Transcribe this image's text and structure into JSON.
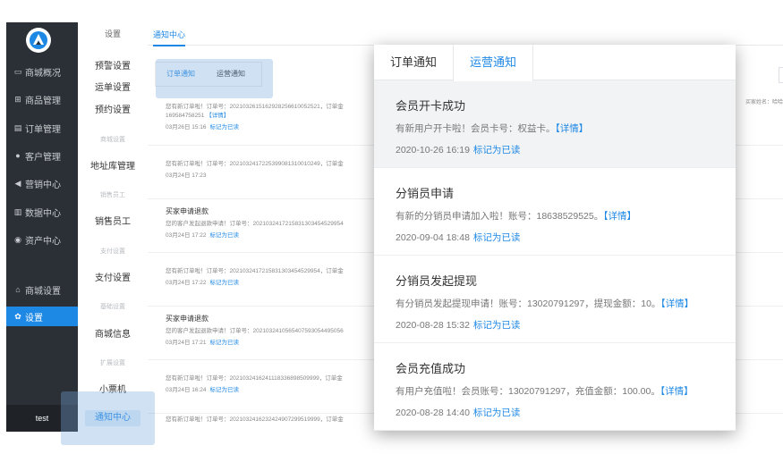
{
  "sidebar": {
    "items": [
      {
        "label": "商城概况",
        "icon": "▭",
        "icon_name": "dashboard-icon"
      },
      {
        "label": "商品管理",
        "icon": "⊞",
        "icon_name": "cart-icon"
      },
      {
        "label": "订单管理",
        "icon": "▤",
        "icon_name": "order-icon"
      },
      {
        "label": "客户管理",
        "icon": "●",
        "icon_name": "user-icon"
      },
      {
        "label": "营销中心",
        "icon": "◀",
        "icon_name": "megaphone-icon"
      },
      {
        "label": "数据中心",
        "icon": "▥",
        "icon_name": "chart-icon"
      },
      {
        "label": "资产中心",
        "icon": "◉",
        "icon_name": "asset-icon"
      },
      {
        "label": "商城设置",
        "icon": "⌂",
        "icon_name": "home-icon"
      },
      {
        "label": "设置",
        "icon": "✿",
        "icon_name": "gear-icon"
      }
    ],
    "user": "test"
  },
  "submenu": {
    "title": "设置",
    "items": [
      "预警设置",
      "运单设置",
      "预约设置",
      "地址库管理",
      "销售员工",
      "支付设置",
      "商城信息",
      "小票机",
      "通知中心"
    ],
    "groups": [
      "商城设置",
      "销售员工",
      "支付设置",
      "基础设置",
      "扩展设置"
    ]
  },
  "content": {
    "tab": "通知中心",
    "mini_tabs": [
      "订单通知",
      "运营通知"
    ],
    "right_label": "买家姓名：哈哈",
    "rows": [
      {
        "title": "",
        "body": "您有新订单啦！订单号：202103261516292825661005252​1，订单金",
        "body2_text": "169584758251",
        "body2_link": "【详情】",
        "date": "03月26日 15:16",
        "mark": "标记为已读"
      },
      {
        "title": "",
        "body": "您有新订单啦！订单号：202103241722539908131001024​9，订单金",
        "date": "03月24日 17:23",
        "mark": ""
      },
      {
        "title": "买家申请退款",
        "body": "您的客户发起退款申请！订单号：202103241721583130345452995​4",
        "date": "03月24日 17:22",
        "mark": "标记为已读"
      },
      {
        "title": "",
        "body": "您有新订单啦！订单号：202103241721583130345452995​4，订单金",
        "date": "03月24日 17:22",
        "mark": "标记为已读"
      },
      {
        "title": "买家申请退款",
        "body": "您的客户发起退款申请！订单号：202103241056540759305449505​6",
        "date": "03月24日 17:21",
        "mark": "标记为已读"
      },
      {
        "title": "",
        "body": "您有新订单啦！订单号：202103241624111833689850999​9，订单金",
        "date": "03月24日 16:24",
        "mark": "标记为已读"
      },
      {
        "title": "",
        "body": "您有新订单啦！订单号：202103241623242490729951999​9，订单金",
        "date": "",
        "mark": ""
      }
    ]
  },
  "popup": {
    "tabs": [
      "订单通知",
      "运营通知"
    ],
    "items": [
      {
        "title": "会员开卡成功",
        "desc": "有新用户开卡啦！会员卡号：权益卡。",
        "link": "【详情】",
        "date": "2020-10-26 16:19",
        "mark": "标记为已读"
      },
      {
        "title": "分销员申请",
        "desc": "有新的分销员申请加入啦！账号：18638529525。",
        "link": "【详情】",
        "date": "2020-09-04 18:48",
        "mark": "标记为已读"
      },
      {
        "title": "分销员发起提现",
        "desc": "有分销员发起提现申请！账号：13020791297，提现金额：10。",
        "link": "【详情】",
        "date": "2020-08-28 15:32",
        "mark": "标记为已读"
      },
      {
        "title": "会员充值成功",
        "desc": "有用户充值啦！会员账号：13020791297，充值金额：100.00。",
        "link": "【详情】",
        "date": "2020-08-28 14:40",
        "mark": "标记为已读"
      }
    ]
  },
  "colors": {
    "accent": "#1e88e5",
    "sidebar": "#2a3036",
    "highlight": "#78aadc"
  }
}
